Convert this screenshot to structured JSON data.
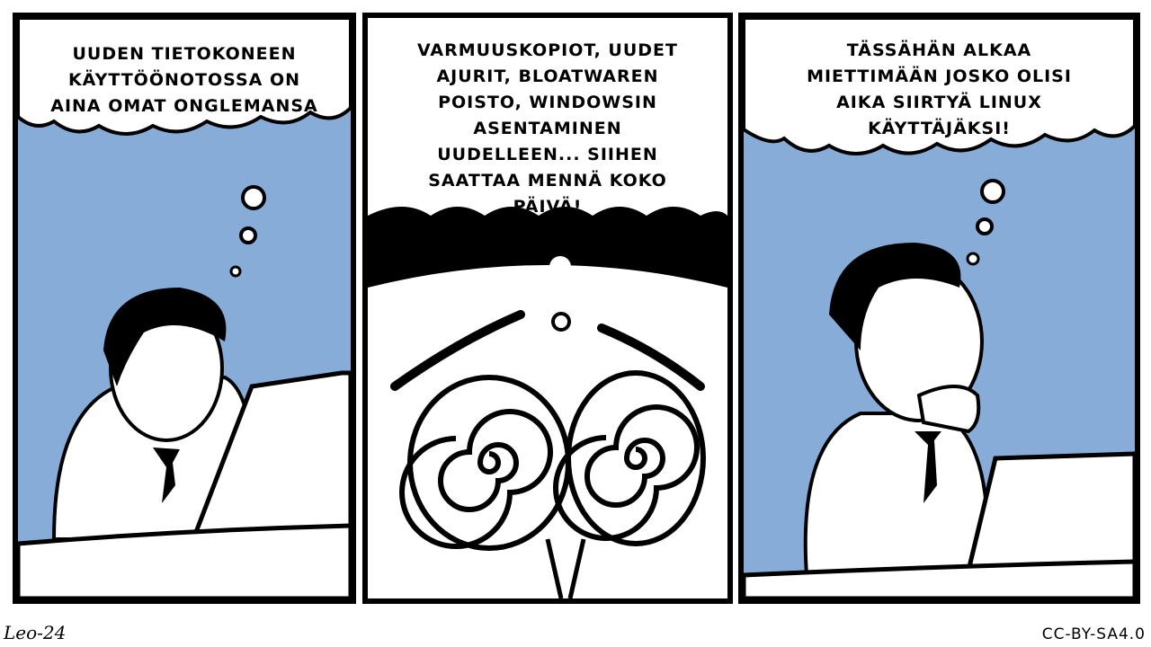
{
  "panels": [
    {
      "caption": "UUDEN TIETOKONEEN KÄYTTÖÖNOTOSSA ON AINA OMAT ONGLEMANSA"
    },
    {
      "caption": "VARMUUSKOPIOT, UUDET AJURIT, BLOATWAREN POISTO, WINDOWSIN ASENTAMINEN UUDELLEEN... SIIHEN SAATTAA MENNÄ KOKO PÄIVÄ!"
    },
    {
      "caption": "TÄSSÄHÄN ALKAA MIETTIMÄÄN JOSKO OLISI AIKA SIIRTYÄ LINUX KÄYTTÄJÄKSI!"
    }
  ],
  "footer": {
    "signature": "Leo-24",
    "license": "CC-BY-SA4.0"
  },
  "colors": {
    "sky": "#88acd8",
    "ink": "#000000",
    "paper": "#ffffff"
  }
}
